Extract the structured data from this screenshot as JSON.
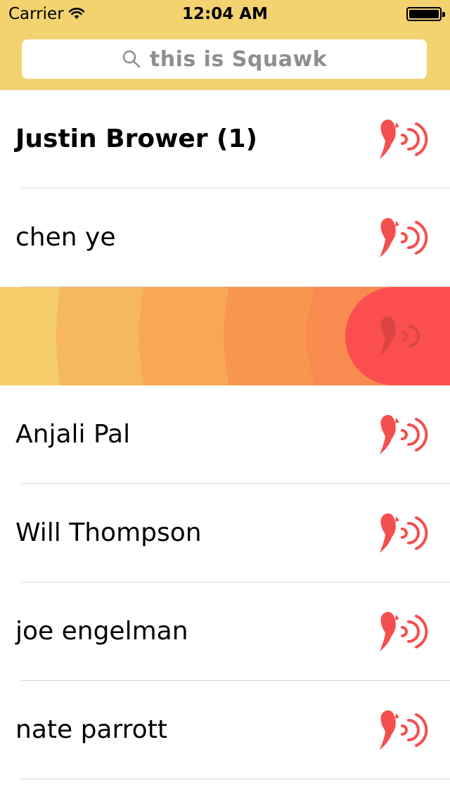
{
  "status_bar": {
    "carrier": "Carrier",
    "time": "12:04 AM"
  },
  "search": {
    "text": "this is Squawk"
  },
  "contacts": [
    {
      "name": "Justin Brower (1)",
      "bold": true,
      "icon": "squawk-bird-icon"
    },
    {
      "name": "chen ye",
      "bold": false,
      "icon": "squawk-bird-icon"
    },
    {
      "name": "",
      "active": true,
      "icon": "squawk-bird-icon"
    },
    {
      "name": "Anjali Pal",
      "bold": false,
      "icon": "squawk-bird-icon"
    },
    {
      "name": "Will Thompson",
      "bold": false,
      "icon": "squawk-bird-icon"
    },
    {
      "name": "joe engelman",
      "bold": false,
      "icon": "squawk-bird-icon"
    },
    {
      "name": "nate parrott",
      "bold": false,
      "icon": "squawk-bird-icon"
    }
  ],
  "colors": {
    "header": "#f3d36f",
    "accent": "#fa4f4e",
    "icon": "#f44f4f"
  }
}
